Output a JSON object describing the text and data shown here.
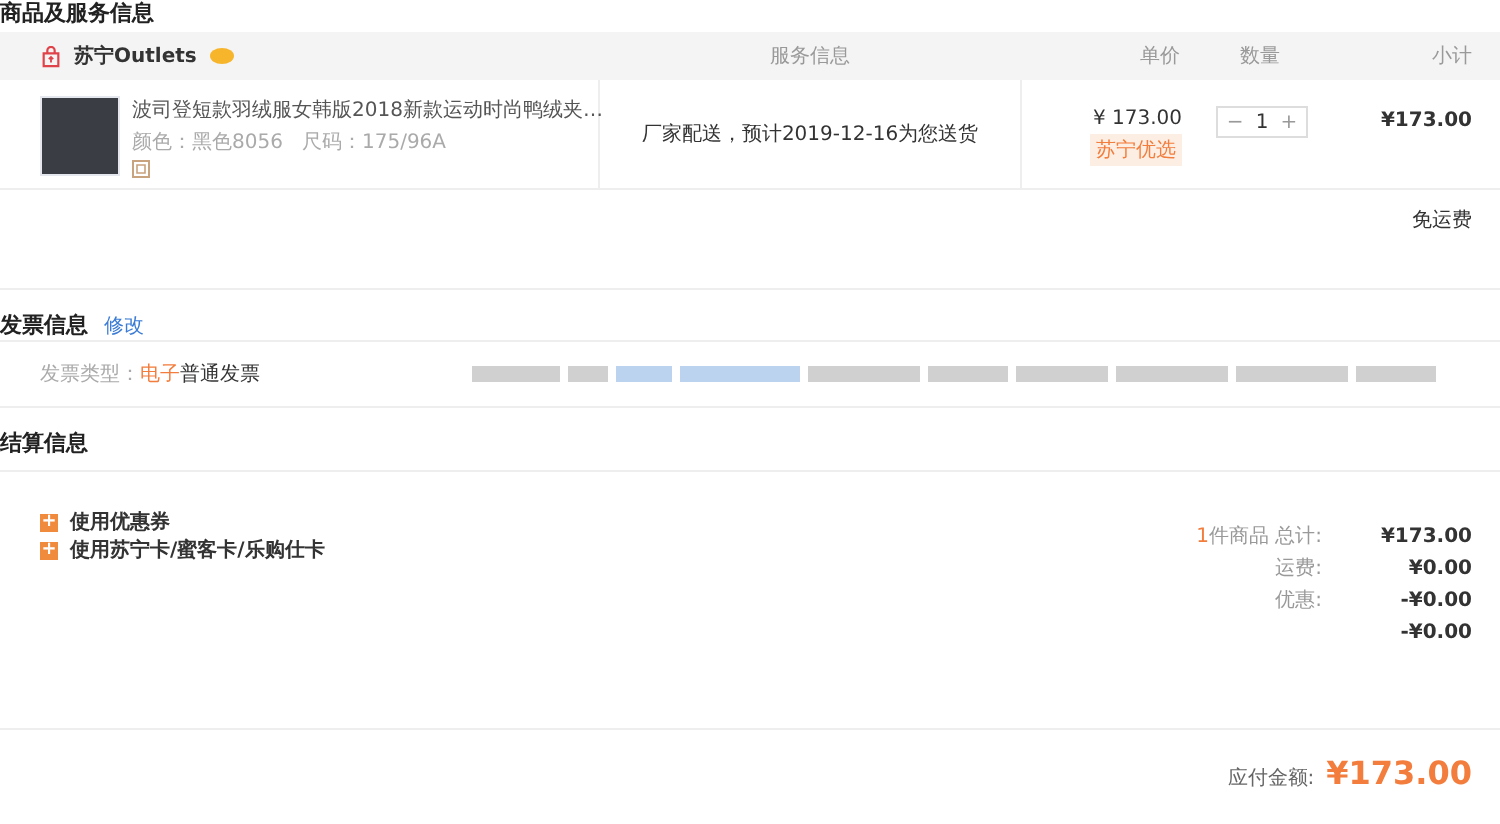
{
  "section_title": "商品及服务信息",
  "table": {
    "columns": [
      "服务信息",
      "单价",
      "数量",
      "小计"
    ],
    "store": {
      "name": "苏宁Outlets"
    },
    "rows": [
      {
        "title": "波司登短款羽绒服女韩版2018新款运动时尚鸭绒夹…",
        "specs": "颜色：黑色8056   尺码：175/96A",
        "service": "厂家配送，预计2019-12-16为您送货",
        "price": "¥ 173.00",
        "tag": "苏宁优选",
        "quantity": "1",
        "minus": "−",
        "plus": "+",
        "subtotal": "¥173.00"
      }
    ],
    "shipping": "免运费"
  },
  "invoice": {
    "title": "发票信息",
    "edit_link": "修改",
    "type_label": "发票类型：",
    "type_highlight": "电子",
    "type_rest": "普通发票"
  },
  "settlement": {
    "title": "结算信息",
    "options": [
      {
        "icon": "+",
        "label": "使用优惠券"
      },
      {
        "icon": "+",
        "label": "使用苏宁卡/蜜客卡/乐购仕卡"
      }
    ],
    "summary": [
      {
        "count": "1",
        "label": "件商品 总计:",
        "value": "¥173.00"
      },
      {
        "label": "运费:",
        "value": "¥0.00"
      },
      {
        "label": "优惠:",
        "value": "-¥0.00"
      },
      {
        "value": "-¥0.00"
      }
    ],
    "payable_label": "应付金额:",
    "payable_value": "¥173.00"
  }
}
